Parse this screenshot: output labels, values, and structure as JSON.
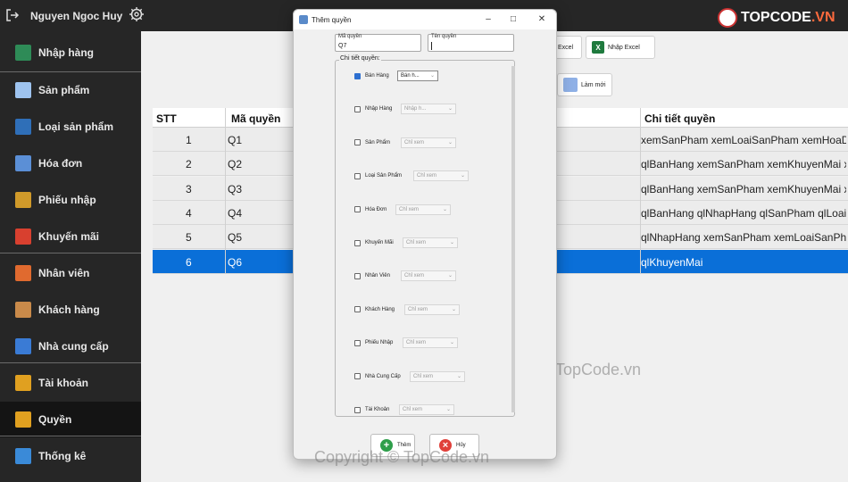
{
  "user": {
    "name": "Nguyen Ngoc Huy"
  },
  "logo": {
    "text": "TOPCODE",
    "suffix": ".VN"
  },
  "sidebar": {
    "items": [
      {
        "label": "Nhập hàng",
        "icon": "import-icon",
        "color": "#2e8b57"
      },
      {
        "label": "Sản phẩm",
        "icon": "products-icon",
        "color": "#9ec3ef"
      },
      {
        "label": "Loại sản phẩm",
        "icon": "category-icon",
        "color": "#2f6fb8"
      },
      {
        "label": "Hóa đơn",
        "icon": "invoice-icon",
        "color": "#5b8fd6"
      },
      {
        "label": "Phiếu nhập",
        "icon": "truck-icon",
        "color": "#d09a2a"
      },
      {
        "label": "Khuyến mãi",
        "icon": "gift-icon",
        "color": "#d8402f"
      },
      {
        "label": "Nhân viên",
        "icon": "employee-icon",
        "color": "#e06a2f"
      },
      {
        "label": "Khách hàng",
        "icon": "customer-icon",
        "color": "#c98a4a"
      },
      {
        "label": "Nhà cung cấp",
        "icon": "supplier-icon",
        "color": "#3a7bd5"
      },
      {
        "label": "Tài khoản",
        "icon": "key-icon",
        "color": "#e0a020"
      },
      {
        "label": "Quyền",
        "icon": "shield-icon",
        "color": "#e0a020"
      },
      {
        "label": "Thống kê",
        "icon": "chart-icon",
        "color": "#3a8ad8"
      }
    ]
  },
  "toolbar": {
    "export_excel": "Excel",
    "import_excel": "Nhập Excel",
    "refresh": "Làm mới"
  },
  "table": {
    "columns": [
      "STT",
      "Mã quyền",
      "Chi tiết quyền"
    ],
    "rows": [
      [
        "1",
        "Q1",
        "xemSanPham xemLoaiSanPham xemHoaDon ..."
      ],
      [
        "2",
        "Q2",
        "qlBanHang xemSanPham xemKhuyenMai xem..."
      ],
      [
        "3",
        "Q3",
        "qlBanHang xemSanPham xemKhuyenMai xem..."
      ],
      [
        "4",
        "Q4",
        "qlBanHang qlNhapHang qlSanPham qlLoaiSa..."
      ],
      [
        "5",
        "Q5",
        "qlNhapHang xemSanPham xemLoaiSanPham ..."
      ],
      [
        "6",
        "Q6",
        "qlKhuyenMai"
      ]
    ]
  },
  "dialog": {
    "title": "Thêm quyền",
    "code_label": "Mã quyền",
    "code_value": "Q7",
    "name_label": "Tên quyền",
    "name_value": "",
    "group_label": "Chi tiết quyền:",
    "permissions": [
      {
        "label": "Bán Hàng",
        "checked": true,
        "select": "Bán h..."
      },
      {
        "label": "Nhập Hàng",
        "checked": false,
        "select": "Nhập h..."
      },
      {
        "label": "Sản Phẩm",
        "checked": false,
        "select": "Chỉ xem"
      },
      {
        "label": "Loại Sản Phẩm",
        "checked": false,
        "select": "Chỉ xem"
      },
      {
        "label": "Hóa Đơn",
        "checked": false,
        "select": "Chỉ xem"
      },
      {
        "label": "Khuyến Mãi",
        "checked": false,
        "select": "Chỉ xem"
      },
      {
        "label": "Nhân Viên",
        "checked": false,
        "select": "Chỉ xem"
      },
      {
        "label": "Khách Hàng",
        "checked": false,
        "select": "Chỉ xem"
      },
      {
        "label": "Phiếu Nhập",
        "checked": false,
        "select": "Chỉ xem"
      },
      {
        "label": "Nhà Cung Cấp",
        "checked": false,
        "select": "Chỉ xem"
      },
      {
        "label": "Tài Khoản",
        "checked": false,
        "select": "Chỉ xem"
      }
    ],
    "add_button": "Thêm",
    "cancel_button": "Hủy"
  },
  "watermarks": {
    "center": "TopCode.vn",
    "bottom": "Copyright © TopCode.vn"
  },
  "colors": {
    "selected_row": "#0a6fd8",
    "sidebar_bg": "#262626",
    "add_green": "#2e9e4a",
    "cancel_red": "#e0403a"
  }
}
